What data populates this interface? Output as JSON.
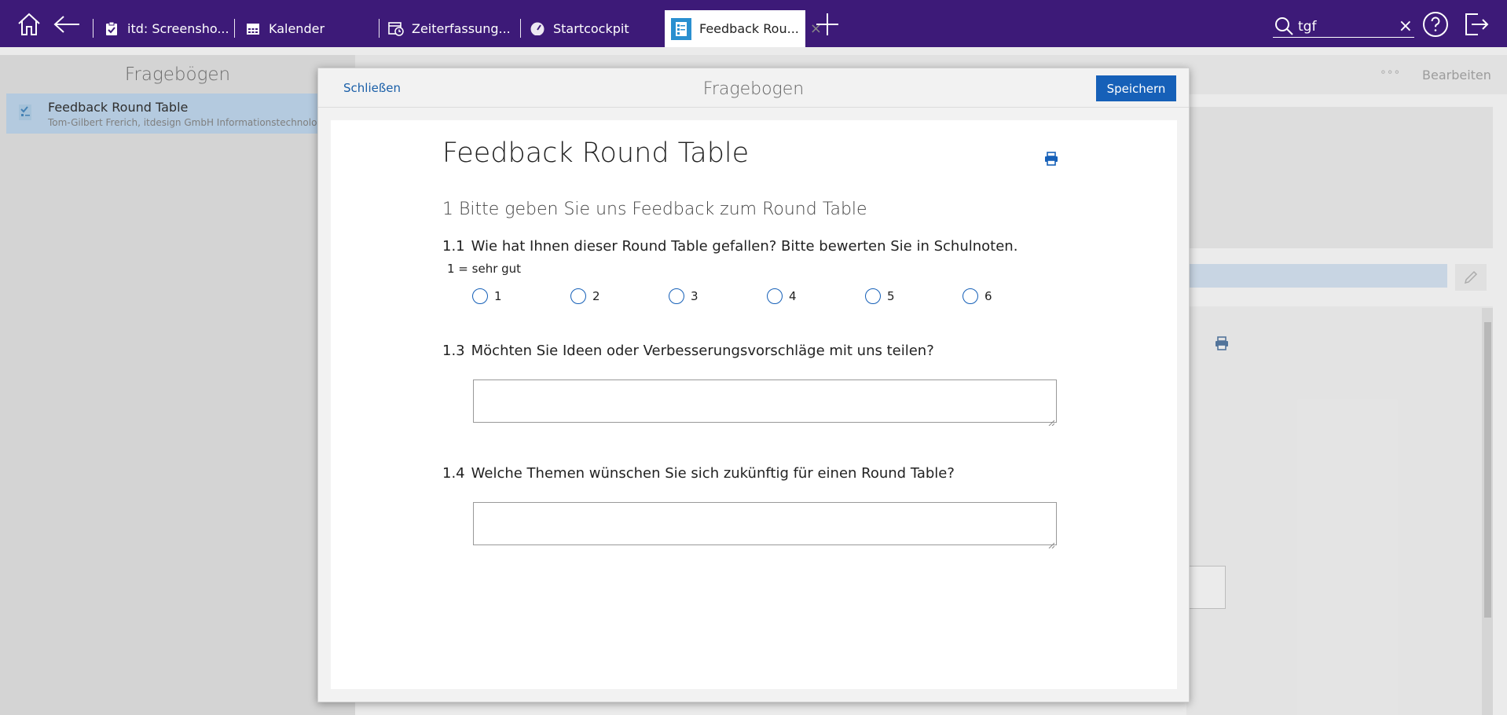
{
  "topbar": {
    "tabs": [
      {
        "label": "itd: Screensho...",
        "icon": "clipboard-check-icon"
      },
      {
        "label": "Kalender",
        "icon": "calendar-icon"
      },
      {
        "label": "Zeiterfassung...",
        "icon": "calendar-clock-icon"
      },
      {
        "label": "Startcockpit",
        "icon": "gauge-icon"
      },
      {
        "label": "Feedback Rou...",
        "icon": "form-icon",
        "active": true,
        "close": "×"
      }
    ],
    "search": {
      "value": "tgf",
      "clear": "×"
    },
    "icons": [
      "home-icon",
      "back-arrow-icon",
      "plus-icon",
      "search-icon",
      "help-icon",
      "logout-icon"
    ],
    "color": "#3d1a78"
  },
  "left": {
    "title": "Fragebögen",
    "item": {
      "title": "Feedback Round Table",
      "subtitle": "Tom-Gilbert Frerich, itdesign GmbH Informationstechnologie"
    }
  },
  "right": {
    "more": "∘∘∘",
    "edit": "Bearbeiten"
  },
  "modal": {
    "close_label": "Schließen",
    "title": "Fragebogen",
    "save_label": "Speichern",
    "accent": "#1660b8",
    "form": {
      "title": "Feedback Round Table",
      "section": "1 Bitte geben Sie uns Feedback zum Round Table",
      "q1": {
        "number": "1.1",
        "text": "Wie hat Ihnen dieser Round Table gefallen? Bitte bewerten Sie in Schulnoten.",
        "hint": "1 = sehr gut",
        "options": [
          "1",
          "2",
          "3",
          "4",
          "5",
          "6"
        ]
      },
      "q3": {
        "number": "1.3",
        "text": "Möchten Sie Ideen oder Verbesserungsvorschläge mit uns teilen?",
        "value": ""
      },
      "q4": {
        "number": "1.4",
        "text": "Welche Themen wünschen Sie sich zukünftig für einen Round Table?",
        "value": ""
      }
    }
  }
}
